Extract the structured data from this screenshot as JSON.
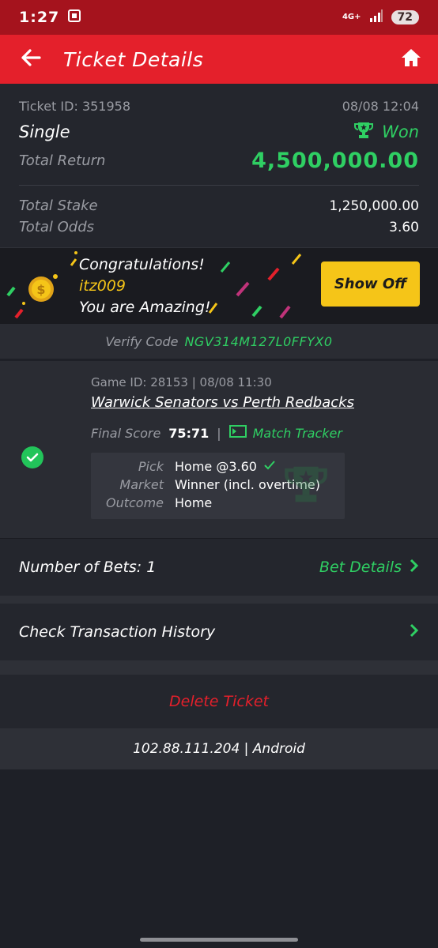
{
  "status_bar": {
    "time": "1:27",
    "network": "4G+",
    "battery": "72"
  },
  "app_bar": {
    "title": "Ticket Details"
  },
  "ticket": {
    "id": "Ticket ID: 351958",
    "datetime": "08/08 12:04",
    "type": "Single",
    "status": "Won",
    "total_return_label": "Total Return",
    "total_return": "4,500,000.00",
    "total_stake_label": "Total Stake",
    "total_stake": "1,250,000.00",
    "total_odds_label": "Total Odds",
    "total_odds": "3.60"
  },
  "congrats": {
    "line1": "Congratulations!",
    "username": "itz009",
    "line3": "You are Amazing!",
    "button": "Show Off"
  },
  "verify": {
    "label": "Verify Code",
    "code": "NGV314M127L0FFYX0"
  },
  "game": {
    "id": "Game ID: 28153 | 08/08 11:30",
    "match": "Warwick Senators vs Perth Redbacks",
    "final_score_label": "Final Score",
    "final_score": "75:71",
    "tracker": "Match Tracker",
    "pick_label": "Pick",
    "pick": "Home @3.60",
    "market_label": "Market",
    "market": "Winner (incl. overtime)",
    "outcome_label": "Outcome",
    "outcome": "Home"
  },
  "bets": {
    "label": "Number of Bets: 1",
    "link": "Bet Details"
  },
  "transactions": {
    "label": "Check Transaction History"
  },
  "delete": {
    "label": "Delete Ticket"
  },
  "footer": {
    "ip": "102.88.111.204 | Android"
  },
  "colors": {
    "brand": "#e4202b",
    "win": "#2fcf63",
    "accent": "#f5c518"
  }
}
